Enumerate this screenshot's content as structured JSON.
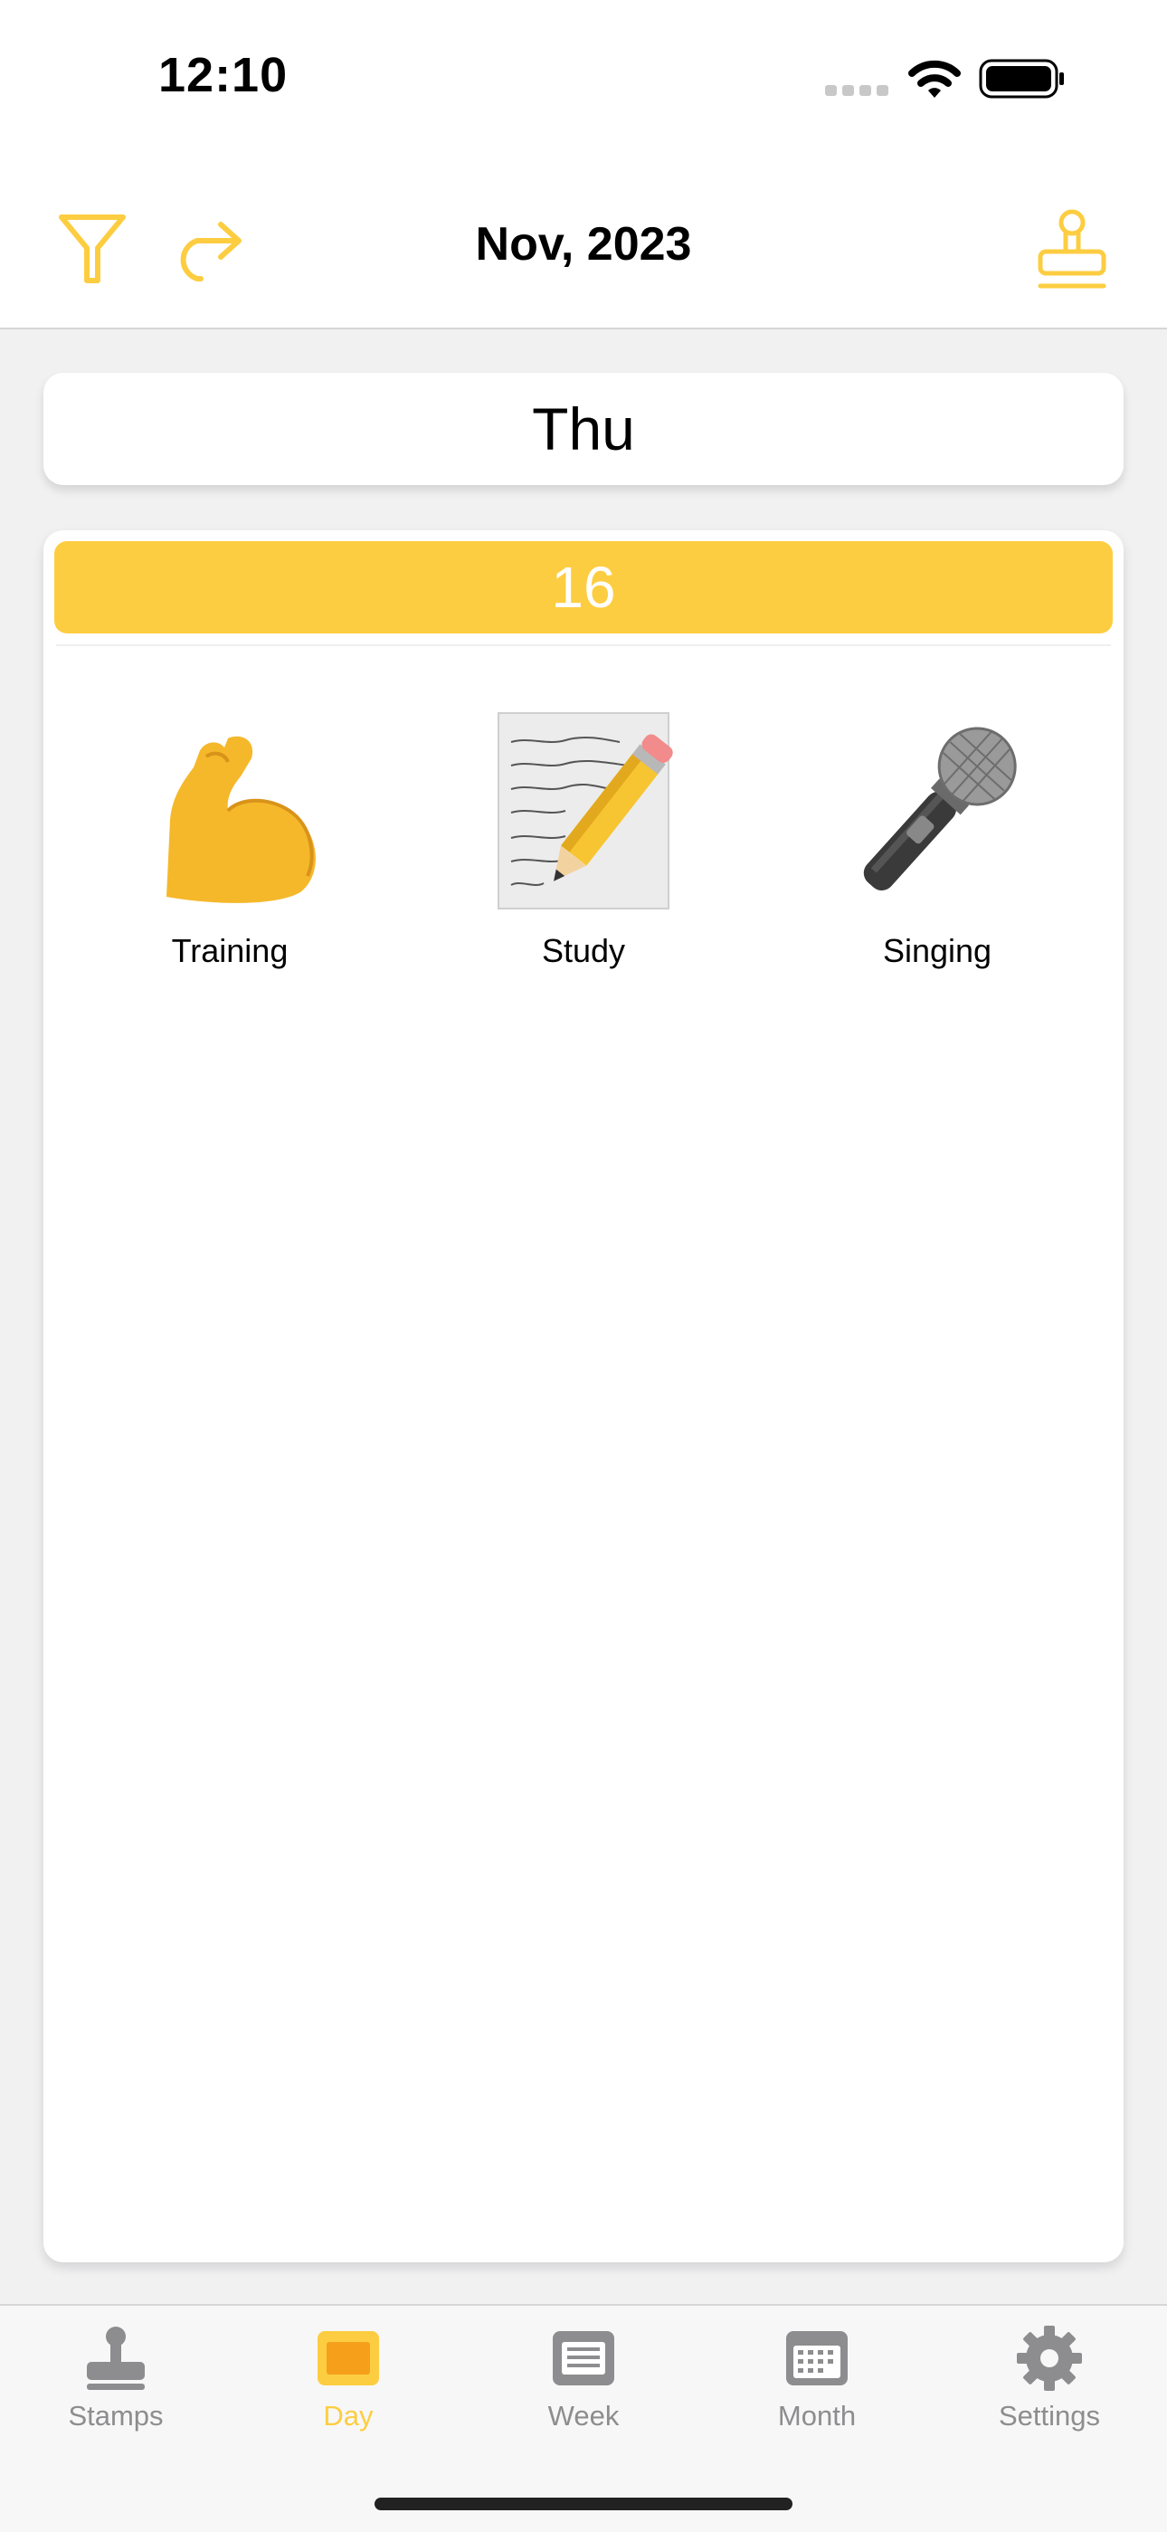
{
  "status_bar": {
    "time": "12:10"
  },
  "nav": {
    "title": "Nov, 2023"
  },
  "day": {
    "weekday": "Thu",
    "date": "16"
  },
  "stamps": [
    {
      "label": "Training",
      "icon": "flexed-biceps-icon"
    },
    {
      "label": "Study",
      "icon": "memo-pencil-icon"
    },
    {
      "label": "Singing",
      "icon": "microphone-icon"
    }
  ],
  "tabs": [
    {
      "label": "Stamps",
      "icon": "stamp-icon",
      "active": false
    },
    {
      "label": "Day",
      "icon": "day-icon",
      "active": true
    },
    {
      "label": "Week",
      "icon": "week-icon",
      "active": false
    },
    {
      "label": "Month",
      "icon": "month-icon",
      "active": false
    },
    {
      "label": "Settings",
      "icon": "gear-icon",
      "active": false
    }
  ],
  "colors": {
    "accent": "#fdcd41",
    "inactive_tab": "#8d8d8f",
    "background": "#f1f1f2"
  }
}
